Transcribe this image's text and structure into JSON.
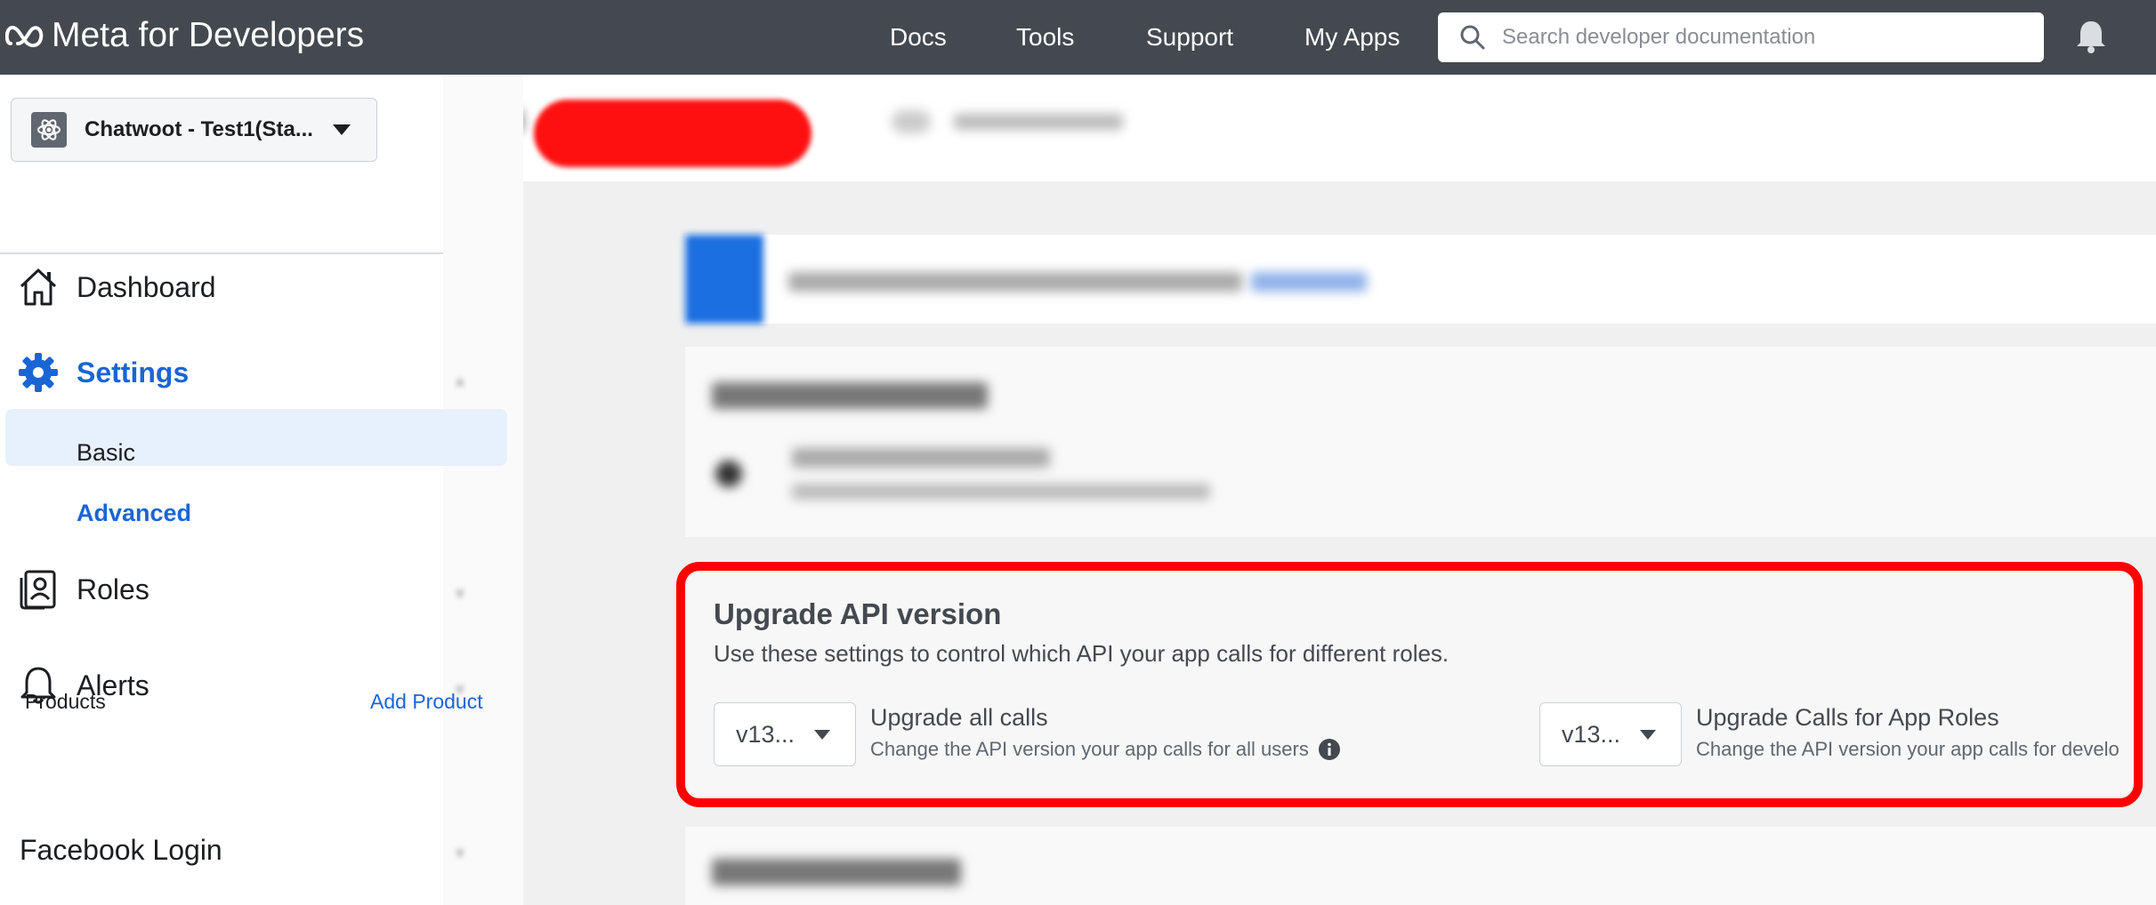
{
  "header": {
    "logo_text": "Meta for Developers",
    "nav": [
      "Docs",
      "Tools",
      "Support",
      "My Apps"
    ],
    "search_placeholder": "Search developer documentation"
  },
  "sidebar": {
    "app_name": "Chatwoot - Test1(Sta...",
    "items": {
      "dashboard": "Dashboard",
      "settings": "Settings",
      "basic": "Basic",
      "advanced": "Advanced",
      "roles": "Roles",
      "alerts": "Alerts",
      "facebook_login": "Facebook Login"
    },
    "products_label": "Products",
    "add_product": "Add Product"
  },
  "upgrade_api": {
    "title": "Upgrade API version",
    "description": "Use these settings to control which API your app calls for different roles.",
    "all_calls": {
      "version": "v13...",
      "title": "Upgrade all calls",
      "subtitle": "Change the API version your app calls for all users"
    },
    "app_roles": {
      "version": "v13...",
      "title": "Upgrade Calls for App Roles",
      "subtitle": "Change the API version your app calls for develo"
    }
  },
  "colors": {
    "topbar": "#444950",
    "accent": "#1a65d6",
    "highlight": "#ff0000"
  }
}
